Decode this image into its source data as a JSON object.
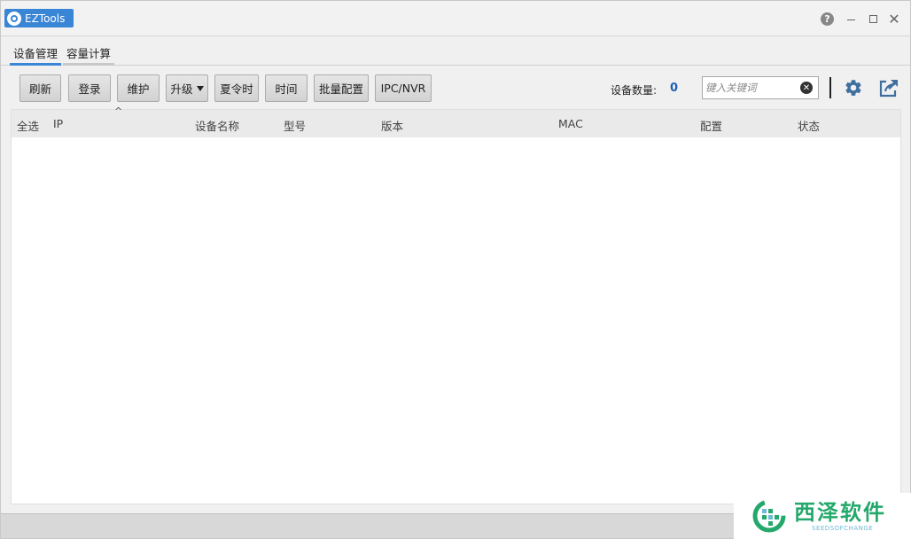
{
  "window": {
    "title": "EZTools",
    "help_symbol": "?",
    "close_symbol": "✕"
  },
  "tabs": [
    {
      "label": "设备管理",
      "active": true
    },
    {
      "label": "容量计算",
      "active": false
    }
  ],
  "toolbar": {
    "refresh_label": "刷新",
    "login_label": "登录",
    "maintain_label": "维护",
    "upgrade_label": "升级",
    "dst_label": "夏令时",
    "time_label": "时间",
    "batch_config_label": "批量配置",
    "ipc_nvr_label": "IPC/NVR",
    "device_count_label": "设备数量:",
    "device_count_value": "0",
    "search_placeholder": "键入关键词",
    "icons": [
      "clear-icon",
      "gear-icon",
      "share-icon"
    ]
  },
  "table": {
    "sort_symbol": "^",
    "columns": [
      "全选",
      "IP",
      "设备名称",
      "型号",
      "版本",
      "MAC",
      "配置",
      "状态"
    ],
    "rows": []
  },
  "watermark": {
    "title": "西泽软件",
    "subtitle": "SEEDSOFCHANGE"
  },
  "colors": {
    "accent": "#3a86d6",
    "count": "#1e5fb8",
    "watermark_green": "#24a86b"
  }
}
